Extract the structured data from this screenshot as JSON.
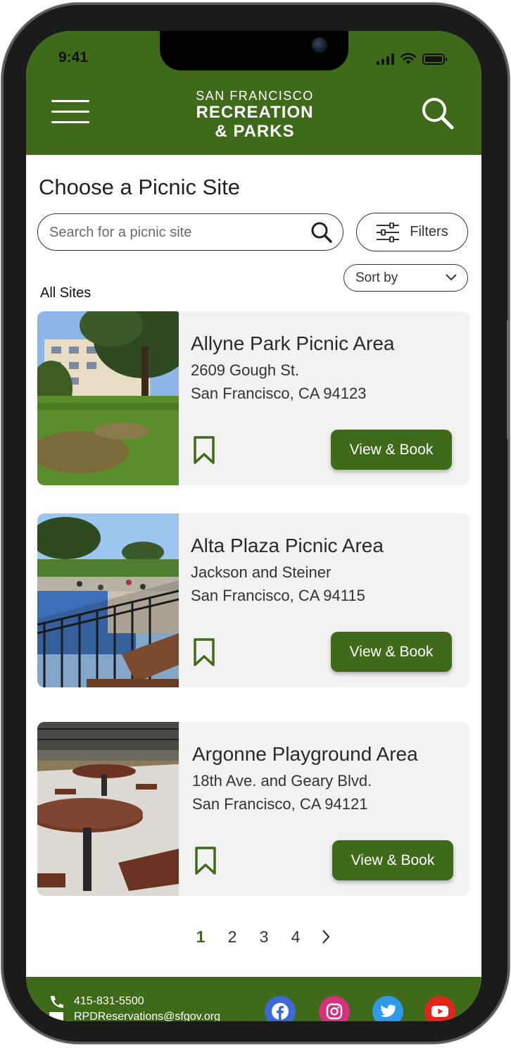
{
  "status_bar": {
    "time": "9:41"
  },
  "header": {
    "logo_line1": "SAN FRANCISCO",
    "logo_line2": "RECREATION",
    "logo_line3": "& PARKS",
    "brand_color": "#3e6a1a"
  },
  "page": {
    "title": "Choose a Picnic Site",
    "search_placeholder": "Search for a picnic site",
    "filters_label": "Filters",
    "sort_label": "Sort by",
    "section_label": "All Sites"
  },
  "sites": [
    {
      "name": "Allyne Park Picnic Area",
      "address1": "2609 Gough St.",
      "address2": "San Francisco, CA 94123",
      "button": "View & Book"
    },
    {
      "name": "Alta Plaza Picnic Area",
      "address1": "Jackson and Steiner",
      "address2": "San Francisco, CA 94115",
      "button": "View & Book"
    },
    {
      "name": "Argonne Playground Area",
      "address1": "18th Ave. and Geary Blvd.",
      "address2": "San Francisco, CA 94121",
      "button": "View & Book"
    }
  ],
  "pagination": {
    "pages": [
      "1",
      "2",
      "3",
      "4"
    ],
    "current": "1"
  },
  "footer": {
    "phone": "415-831-5500",
    "email": "RPDReservations@sfgov.org",
    "social": [
      "facebook-icon",
      "instagram-icon",
      "twitter-icon",
      "youtube-icon"
    ]
  }
}
